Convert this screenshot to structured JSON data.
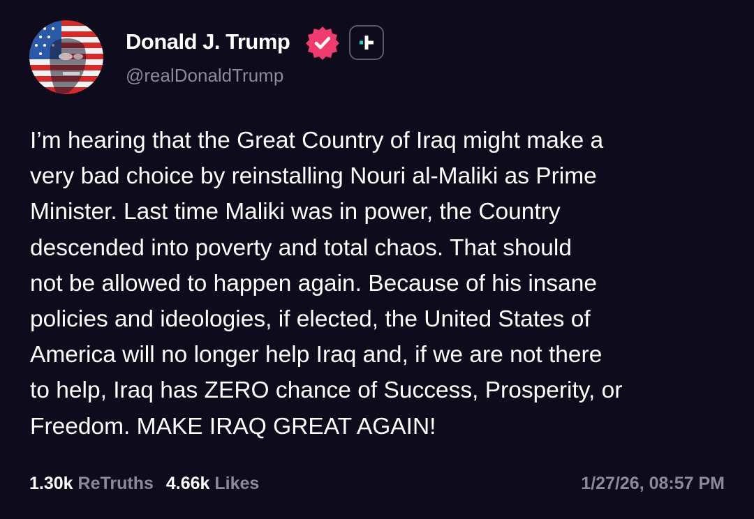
{
  "post": {
    "author": {
      "display_name": "Donald J. Trump",
      "handle": "@realDonaldTrump",
      "verified": true,
      "avatar_icon": "flag-portrait-avatar",
      "verified_icon": "verified-badge-icon",
      "follow_icon": "plus-icon"
    },
    "body": "I’m hearing that the Great Country of Iraq might make a\nvery bad choice by reinstalling Nouri al-Maliki as Prime\nMinister. Last time Maliki was in power, the Country\ndescended into poverty and total chaos. That should\nnot be allowed to happen again. Because of his insane\npolicies and ideologies, if elected, the United States of\nAmerica will no longer help Iraq and, if we are not there\nto help, Iraq has ZERO chance of Success, Prosperity, or\nFreedom. MAKE IRAQ GREAT AGAIN!",
    "stats": {
      "retruths_count": "1.30k",
      "retruths_label": "ReTruths",
      "likes_count": "4.66k",
      "likes_label": "Likes"
    },
    "timestamp": "1/27/26, 08:57 PM"
  },
  "colors": {
    "background": "#0e0b1d",
    "text_primary": "#ffffff",
    "text_secondary": "#8b8a97",
    "verified_badge": "#ef3b6d",
    "follow_accent": "#1fd8c4"
  }
}
